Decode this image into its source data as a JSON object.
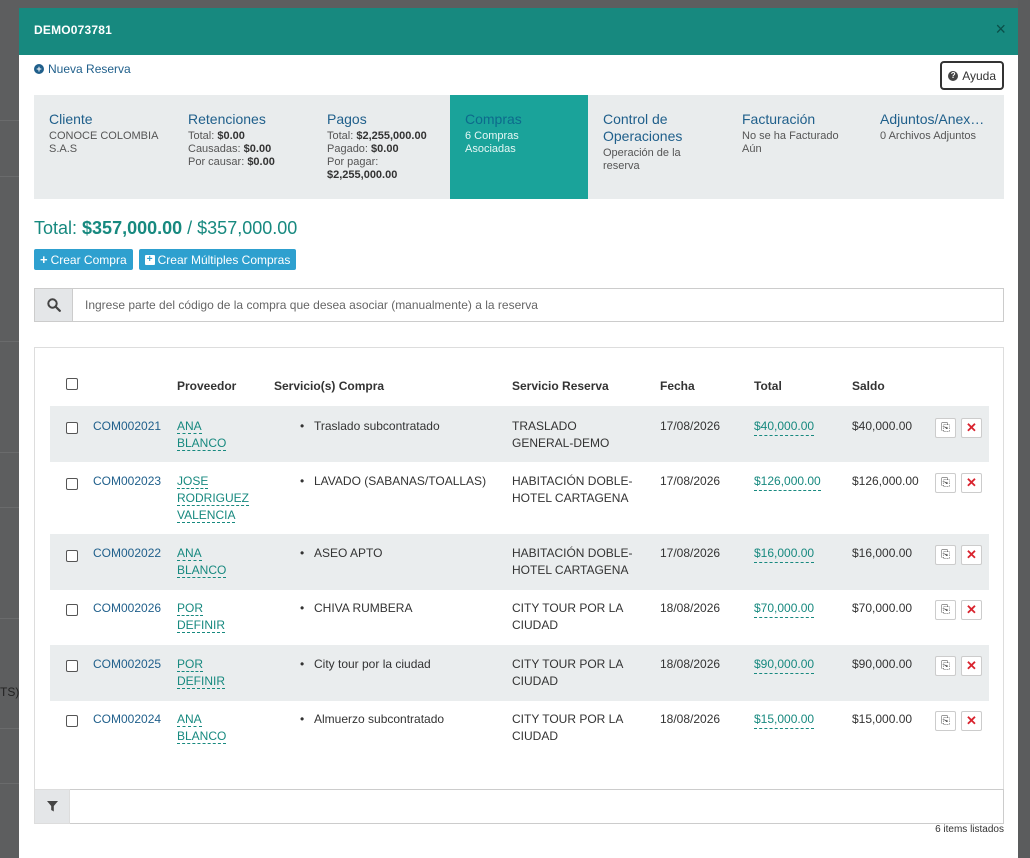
{
  "modal": {
    "title": "DEMO073781",
    "close": "×",
    "new_reservation": "Nueva Reserva",
    "help": "Ayuda"
  },
  "background": {
    "partial_text": "TS)"
  },
  "tabs": [
    {
      "title": "Cliente",
      "lines": [
        "CONOCE COLOMBIA",
        "S.A.S"
      ]
    },
    {
      "title": "Retenciones",
      "lines": [
        [
          "Total: ",
          "$0.00"
        ],
        [
          "Causadas: ",
          "$0.00"
        ],
        [
          "Por causar: ",
          "$0.00"
        ]
      ]
    },
    {
      "title": "Pagos",
      "lines": [
        [
          "Total: ",
          "$2,255,000.00"
        ],
        [
          "Pagado: ",
          "$0.00"
        ],
        [
          "Por pagar:",
          ""
        ],
        [
          "",
          "$2,255,000.00"
        ]
      ]
    },
    {
      "title": "Compras",
      "lines": [
        "6 Compras",
        "Asociadas"
      ],
      "active": true
    },
    {
      "title": "Control de Operaciones",
      "lines": [
        "Operación de la",
        "reserva"
      ]
    },
    {
      "title": "Facturación",
      "lines": [
        "No se ha Facturado",
        "Aún"
      ]
    },
    {
      "title": "Adjuntos/Anex…",
      "lines": [
        "0 Archivos Adjuntos"
      ]
    }
  ],
  "total": {
    "label": "Total: ",
    "value": "$357,000.00",
    "sep": " / ",
    "max": "$357,000.00"
  },
  "buttons": {
    "create": "Crear Compra",
    "create_multiple": "Crear Múltiples Compras"
  },
  "search": {
    "placeholder": "Ingrese parte del código de la compra que desea asociar (manualmente) a la reserva"
  },
  "table": {
    "headers": {
      "proveedor": "Proveedor",
      "servicios": "Servicio(s) Compra",
      "servicio_reserva": "Servicio Reserva",
      "fecha": "Fecha",
      "total": "Total",
      "saldo": "Saldo"
    },
    "rows": [
      {
        "code": "COM002021",
        "provider": [
          "ANA",
          "BLANCO"
        ],
        "service": "Traslado subcontratado",
        "reserva": [
          "TRASLADO",
          "GENERAL-DEMO"
        ],
        "date": "17/08/2026",
        "total": "$40,000.00",
        "saldo": "$40,000.00"
      },
      {
        "code": "COM002023",
        "provider": [
          "JOSE",
          "RODRIGUEZ",
          "VALENCIA"
        ],
        "service": "LAVADO (SABANAS/TOALLAS)",
        "reserva": [
          "HABITACIÓN DOBLE-",
          "HOTEL CARTAGENA"
        ],
        "date": "17/08/2026",
        "total": "$126,000.00",
        "saldo": "$126,000.00"
      },
      {
        "code": "COM002022",
        "provider": [
          "ANA",
          "BLANCO"
        ],
        "service": "ASEO APTO",
        "reserva": [
          "HABITACIÓN DOBLE-",
          "HOTEL CARTAGENA"
        ],
        "date": "17/08/2026",
        "total": "$16,000.00",
        "saldo": "$16,000.00"
      },
      {
        "code": "COM002026",
        "provider": [
          "POR",
          "DEFINIR"
        ],
        "service": "CHIVA RUMBERA",
        "reserva": [
          "CITY TOUR POR LA",
          "CIUDAD"
        ],
        "date": "18/08/2026",
        "total": "$70,000.00",
        "saldo": "$70,000.00"
      },
      {
        "code": "COM002025",
        "provider": [
          "POR",
          "DEFINIR"
        ],
        "service": "City tour por la ciudad",
        "reserva": [
          "CITY TOUR POR LA",
          "CIUDAD"
        ],
        "date": "18/08/2026",
        "total": "$90,000.00",
        "saldo": "$90,000.00"
      },
      {
        "code": "COM002024",
        "provider": [
          "ANA",
          "BLANCO"
        ],
        "service": "Almuerzo subcontratado",
        "reserva": [
          "CITY TOUR POR LA",
          "CIUDAD"
        ],
        "date": "18/08/2026",
        "total": "$15,000.00",
        "saldo": "$15,000.00"
      }
    ],
    "items_count": "6 items listados"
  },
  "colors": {
    "header": "#17897f",
    "active_tab": "#1aa39a",
    "link": "#1f5f8b",
    "button": "#2ea0cf",
    "delete": "#d9232e"
  },
  "icons": {
    "new_reservation": "plus-circle-icon",
    "help": "question-circle-icon",
    "search": "search-icon",
    "filter": "filter-icon",
    "copy": "copy-icon",
    "delete": "times-icon"
  }
}
